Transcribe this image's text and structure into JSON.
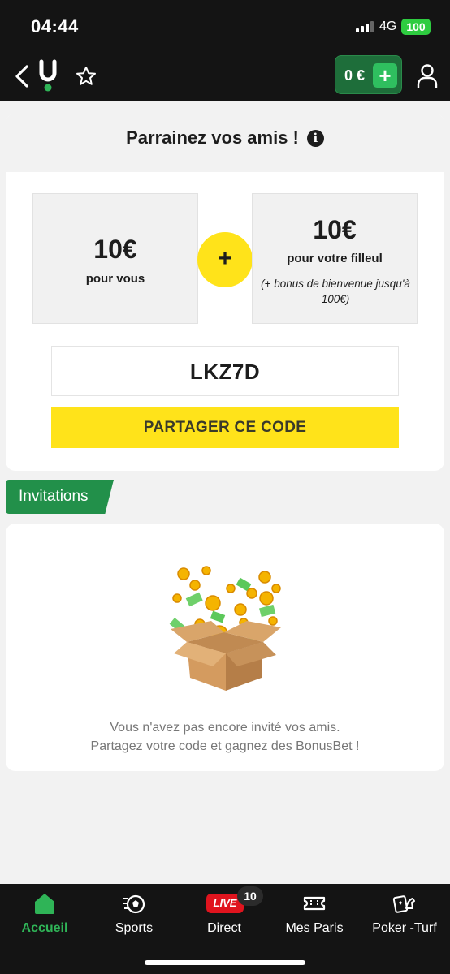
{
  "status_bar": {
    "time": "04:44",
    "network": "4G",
    "battery": "100"
  },
  "header": {
    "wallet_amount": "0 €",
    "wallet_add": "+"
  },
  "main": {
    "title": "Parrainez vos amis !",
    "you": {
      "amount": "10€",
      "label": "pour vous"
    },
    "plus": "+",
    "friend": {
      "amount": "10€",
      "label": "pour votre filleul",
      "note": "(+ bonus de bienvenue jusqu'à 100€)"
    },
    "code": "LKZ7D",
    "share_label": "PARTAGER CE CODE"
  },
  "invitations": {
    "tab_label": "Invitations",
    "empty_line1": "Vous n'avez pas encore invité vos amis.",
    "empty_line2": "Partagez votre code et gagnez des BonusBet !"
  },
  "nav": {
    "items": [
      {
        "label": "Accueil",
        "icon": "home-icon",
        "active": true
      },
      {
        "label": "Sports",
        "icon": "soccer-ball-icon"
      },
      {
        "label": "Direct",
        "icon": "live-icon",
        "badge": "LIVE",
        "count": "10"
      },
      {
        "label": "Mes Paris",
        "icon": "ticket-icon"
      },
      {
        "label": "Poker -Turf",
        "icon": "cards-horse-icon"
      }
    ]
  },
  "colors": {
    "accent_green": "#2fb457",
    "yellow": "#ffe31a",
    "live_red": "#e0141e"
  }
}
